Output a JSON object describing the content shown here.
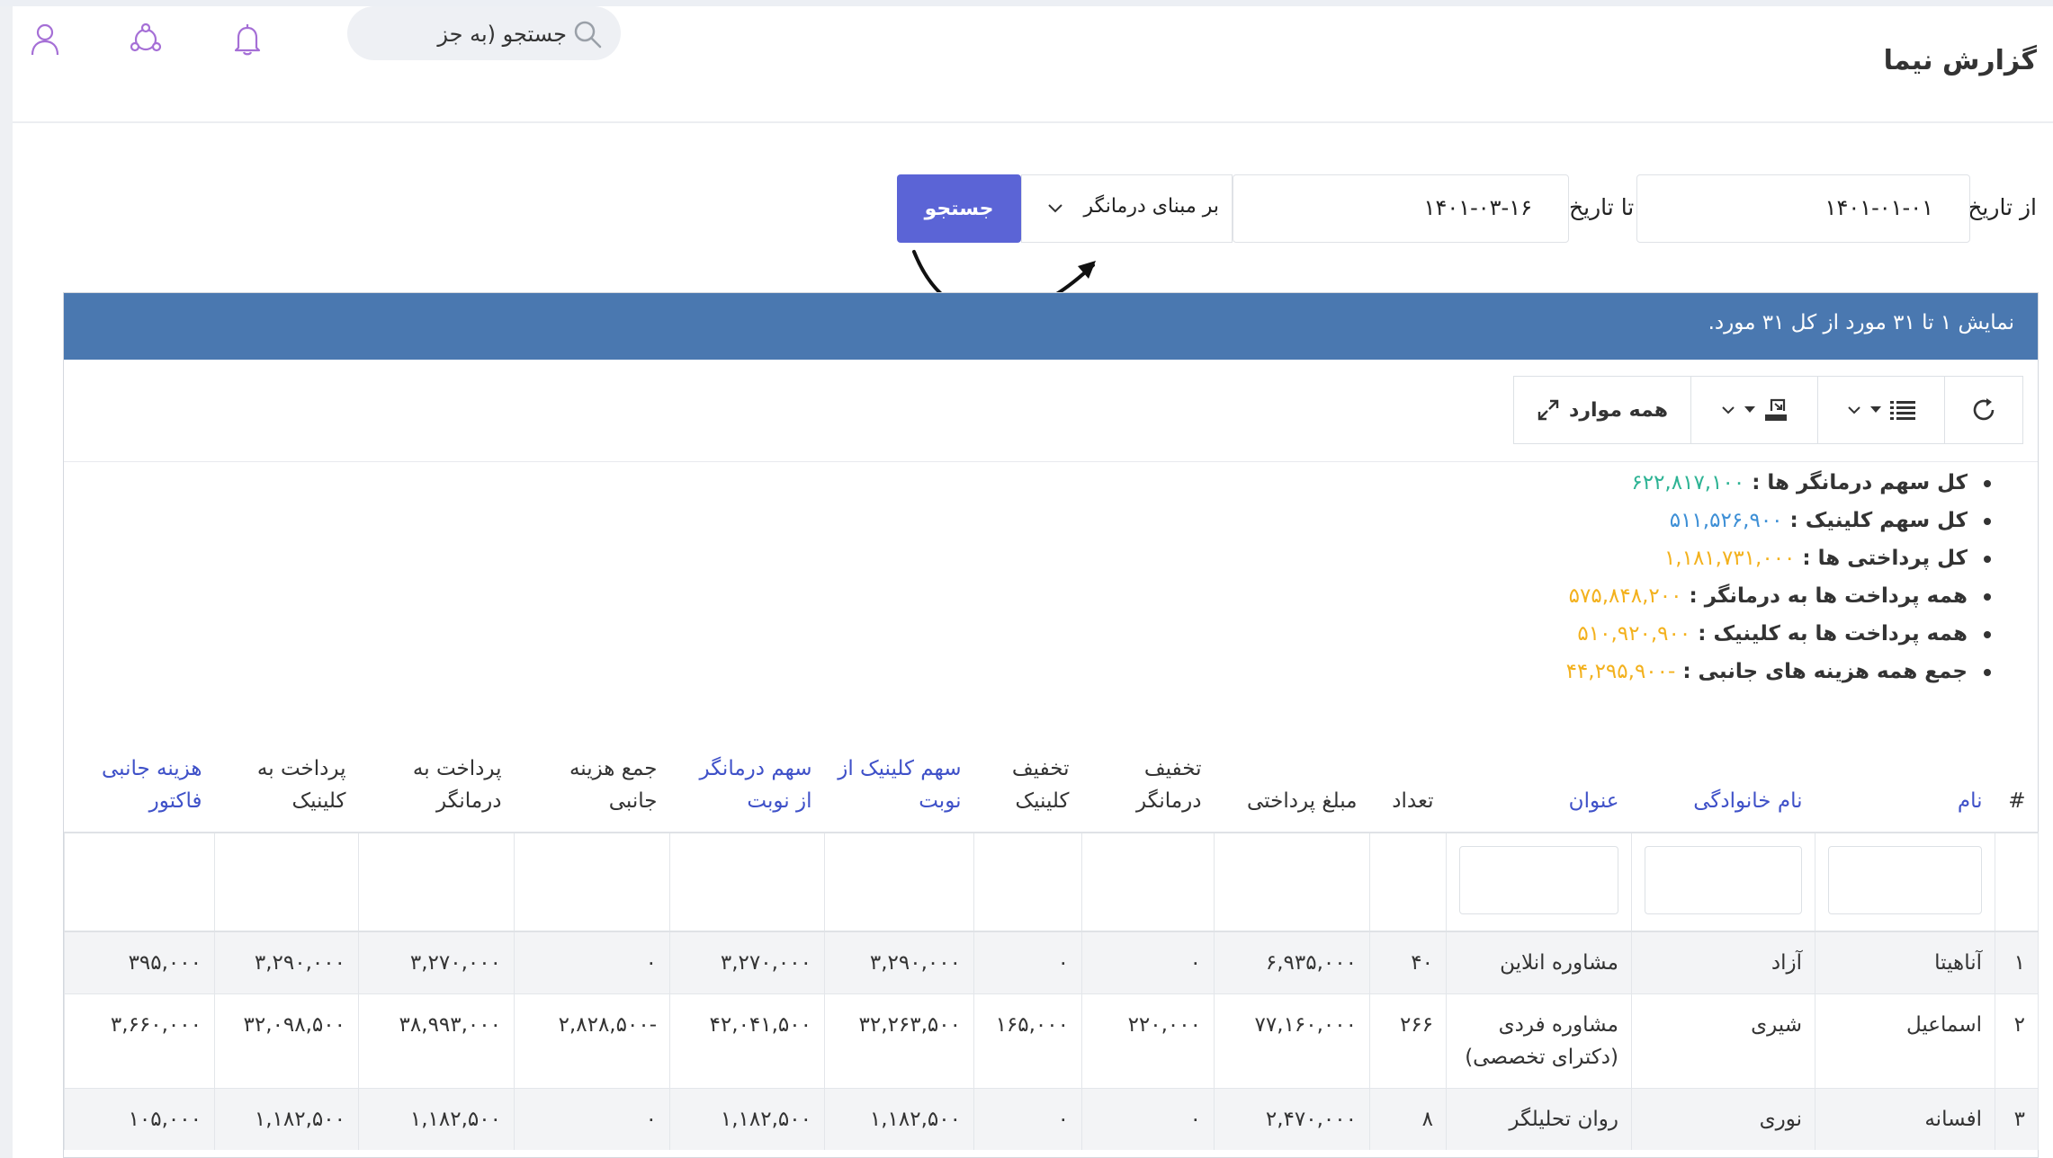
{
  "header": {
    "title": "گزارش نیما",
    "search_placeholder": "جستجو (به جز"
  },
  "filters": {
    "from_label": "از تاریخ",
    "from_value": "۱۴۰۱-۰۱-۰۱",
    "to_label": "تا تاریخ",
    "to_value": "۱۴۰۱-۰۳-۱۶",
    "basis_value": "بر مبنای درمانگر",
    "search_button": "جستجو"
  },
  "panel": {
    "summary_text": "نمایش ۱ تا ۳۱ مورد از کل ۳۱ مورد."
  },
  "toolbar": {
    "all_label": "همه موارد"
  },
  "stats": [
    {
      "label": "کل سهم درمانگر ها :",
      "value": "۶۲۲,۸۱۷,۱۰۰",
      "color": "green"
    },
    {
      "label": "کل سهم کلینیک :",
      "value": "۵۱۱,۵۲۶,۹۰۰",
      "color": "blue"
    },
    {
      "label": "کل پرداختی ها :",
      "value": "۱,۱۸۱,۷۳۱,۰۰۰",
      "color": "yellow"
    },
    {
      "label": "همه پرداخت ها به درمانگر :",
      "value": "۵۷۵,۸۴۸,۲۰۰",
      "color": "yellow"
    },
    {
      "label": "همه پرداخت ها به کلینیک :",
      "value": "۵۱۰,۹۲۰,۹۰۰",
      "color": "yellow"
    },
    {
      "label": "جمع همه هزینه های جانبی :",
      "value": "-۴۴,۲۹۵,۹۰۰",
      "color": "yellow"
    }
  ],
  "table": {
    "headers": [
      "#",
      "نام",
      "نام خانوادگی",
      "عنوان",
      "تعداد",
      "مبلغ پرداختی",
      "تخفیف درمانگر",
      "تخفیف کلینیک",
      "سهم کلینیک از نوبت",
      "سهم درمانگر از نوبت",
      "جمع هزینه جانبی",
      "پرداخت به درمانگر",
      "پرداخت به کلینیک",
      "هزینه جانبی فاکتور"
    ],
    "rows": [
      [
        "۱",
        "آناهیتا",
        "آزاد",
        "مشاوره انلاین",
        "۴۰",
        "۶,۹۳۵,۰۰۰",
        "۰",
        "۰",
        "۳,۲۹۰,۰۰۰",
        "۳,۲۷۰,۰۰۰",
        "۰",
        "۳,۲۷۰,۰۰۰",
        "۳,۲۹۰,۰۰۰",
        "۳۹۵,۰۰۰"
      ],
      [
        "۲",
        "اسماعیل",
        "شیری",
        "مشاوره فردی (دکترای تخصصی)",
        "۲۶۶",
        "۷۷,۱۶۰,۰۰۰",
        "۲۲۰,۰۰۰",
        "۱۶۵,۰۰۰",
        "۳۲,۲۶۳,۵۰۰",
        "۴۲,۰۴۱,۵۰۰",
        "-۲,۸۲۸,۵۰۰",
        "۳۸,۹۹۳,۰۰۰",
        "۳۲,۰۹۸,۵۰۰",
        "۳,۶۶۰,۰۰۰"
      ],
      [
        "۳",
        "افسانه",
        "نوری",
        "روان تحلیلگر",
        "۸",
        "۲,۴۷۰,۰۰۰",
        "۰",
        "۰",
        "۱,۱۸۲,۵۰۰",
        "۱,۱۸۲,۵۰۰",
        "۰",
        "۱,۱۸۲,۵۰۰",
        "۱,۱۸۲,۵۰۰",
        "۱۰۵,۰۰۰"
      ]
    ]
  },
  "colors": {
    "accent": "#5b64d6",
    "panel_header": "#4a78b0",
    "green": "#2db394",
    "blue": "#3d8fd6",
    "yellow": "#f3b11d",
    "link": "#3f51c8"
  }
}
